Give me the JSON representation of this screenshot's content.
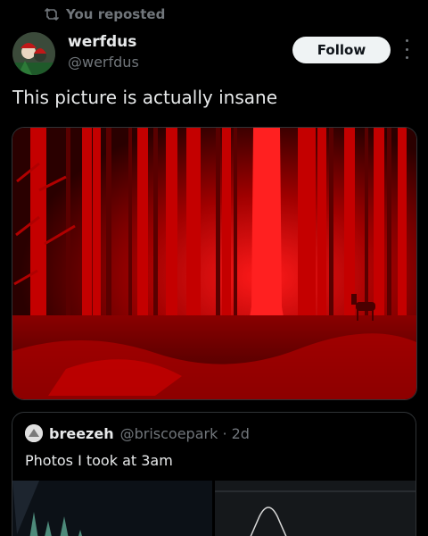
{
  "repost": {
    "label": "You reposted",
    "icon": "repost-icon"
  },
  "author": {
    "display_name": "werfdus",
    "handle": "@werfdus"
  },
  "actions": {
    "follow_label": "Follow",
    "more_icon": "more-icon"
  },
  "post": {
    "text": "This picture is actually insane"
  },
  "quote": {
    "display_name": "breezeh",
    "handle_time": "@briscoepark · 2d",
    "text": "Photos I took at 3am"
  },
  "colors": {
    "background": "#000000",
    "muted": "#71767b",
    "text": "#e7e9ea",
    "follow_bg": "#eff3f4",
    "forest_red": "#e00000"
  }
}
